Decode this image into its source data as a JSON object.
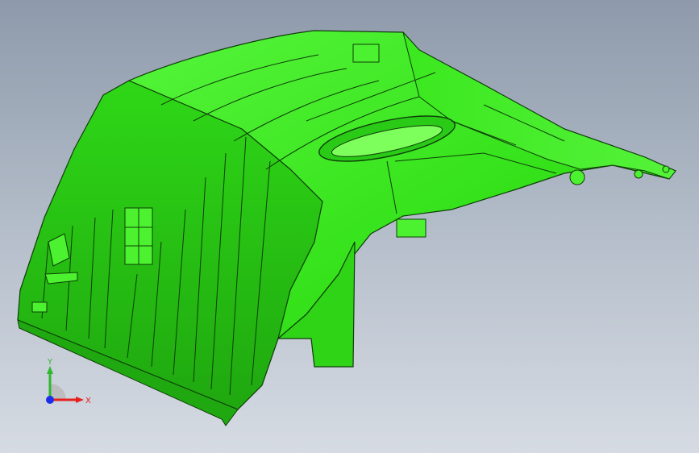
{
  "viewport": {
    "background_top": "#8e9aab",
    "background_bottom": "#d6dbe3"
  },
  "model": {
    "part_color": "#3bea1c",
    "highlight_color": "#7dff5c",
    "shadow_color": "#1f9f10",
    "edge_color": "#0e3d08"
  },
  "triad": {
    "x_label": "X",
    "y_label": "Y",
    "x_color": "#e8201c",
    "y_color": "#2eb82e",
    "z_color": "#1c2ee8"
  }
}
